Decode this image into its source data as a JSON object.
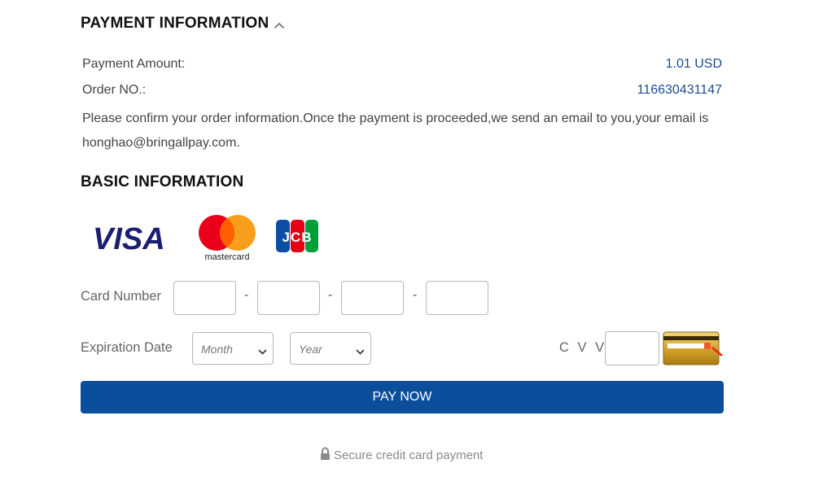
{
  "payment": {
    "title": "PAYMENT INFORMATION",
    "amount_label": "Payment Amount:",
    "amount_value": "1.01 USD",
    "order_label": "Order NO.:",
    "order_value": "116630431147",
    "notice": "Please confirm your order information.Once the payment is proceeded,we send an email to you,your email is honghao@bringallpay.com."
  },
  "basic": {
    "title": "BASIC INFORMATION",
    "brands": {
      "visa": "VISA",
      "mastercard": "mastercard",
      "jcb": "JCB"
    },
    "card_number_label": "Card Number",
    "separator": "-",
    "card_number_values": [
      "",
      "",
      "",
      ""
    ],
    "expiration_label": "Expiration Date",
    "month_placeholder": "Month",
    "year_placeholder": "Year",
    "cvv_label": "C V V",
    "cvv_value": ""
  },
  "action": {
    "pay_label": "PAY NOW"
  },
  "footer": {
    "secure_text": "Secure credit card payment"
  },
  "icons": {
    "caret": "chevron-up-icon",
    "select_arrow": "chevron-down-icon",
    "lock": "lock-icon",
    "cvv_card": "card-back-icon"
  },
  "colors": {
    "accent": "#0a4e9c",
    "value_text": "#1d4d8f",
    "title_text": "#111111"
  }
}
